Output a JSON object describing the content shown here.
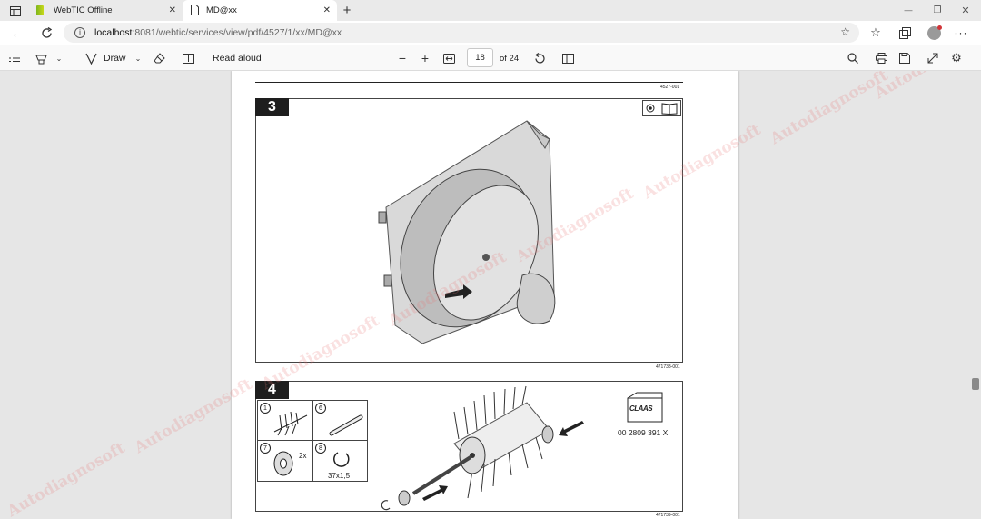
{
  "tabs": [
    {
      "title": "WebTIC Offline",
      "close": "✕"
    },
    {
      "title": "MD@xx",
      "close": "✕"
    }
  ],
  "new_tab": "+",
  "window_controls": {
    "minimize": "—",
    "restore": "❐",
    "close": "✕"
  },
  "address": {
    "host": "localhost",
    "rest": ":8081/webtic/services/view/pdf/4527/1/xx/MD@xx"
  },
  "pdf_toolbar": {
    "draw_label": "Draw",
    "read_aloud_label": "Read aloud",
    "page_current": "18",
    "page_total": "of 24"
  },
  "document": {
    "header_code": "4527-001",
    "step3": {
      "number": "3",
      "figure_code": "471738-001"
    },
    "step4": {
      "number": "4",
      "figure_code": "471739-001",
      "parts": [
        {
          "num": "1",
          "qty": ""
        },
        {
          "num": "6",
          "qty": ""
        },
        {
          "num": "7",
          "qty": "2x"
        },
        {
          "num": "8",
          "qty": "37x1,5"
        }
      ],
      "brand": "CLAAS",
      "part_number": "00 2809 391 X"
    },
    "watermark": "Autodiagnosoft"
  },
  "colors": {
    "accent": "#0067c0",
    "badge": "#1e1e1e",
    "watermark": "#e67878"
  }
}
